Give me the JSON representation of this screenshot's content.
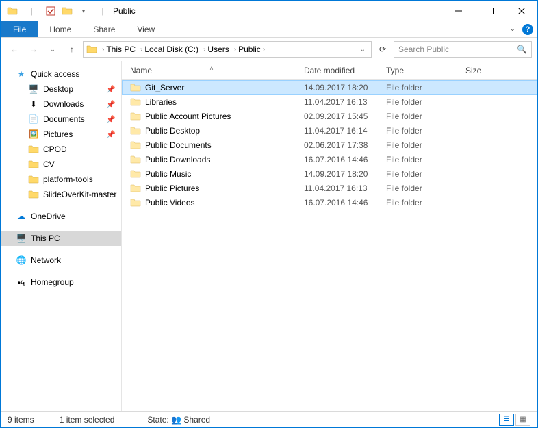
{
  "titlebar": {
    "title": "Public"
  },
  "ribbon": {
    "file": "File",
    "tabs": [
      "Home",
      "Share",
      "View"
    ]
  },
  "breadcrumbs": [
    "This PC",
    "Local Disk (C:)",
    "Users",
    "Public"
  ],
  "search": {
    "placeholder": "Search Public"
  },
  "columns": {
    "name": "Name",
    "date": "Date modified",
    "type": "Type",
    "size": "Size"
  },
  "navpane": {
    "quick_access": "Quick access",
    "items": [
      {
        "label": "Desktop",
        "pinned": true,
        "icon": "desktop"
      },
      {
        "label": "Downloads",
        "pinned": true,
        "icon": "downloads"
      },
      {
        "label": "Documents",
        "pinned": true,
        "icon": "documents"
      },
      {
        "label": "Pictures",
        "pinned": true,
        "icon": "pictures"
      },
      {
        "label": "CPOD",
        "pinned": false,
        "icon": "folder"
      },
      {
        "label": "CV",
        "pinned": false,
        "icon": "folder"
      },
      {
        "label": "platform-tools",
        "pinned": false,
        "icon": "folder"
      },
      {
        "label": "SlideOverKit-master",
        "pinned": false,
        "icon": "folder"
      }
    ],
    "onedrive": "OneDrive",
    "thispc": "This PC",
    "network": "Network",
    "homegroup": "Homegroup"
  },
  "files": [
    {
      "name": "Git_Server",
      "date": "14.09.2017 18:20",
      "type": "File folder",
      "selected": true
    },
    {
      "name": "Libraries",
      "date": "11.04.2017 16:13",
      "type": "File folder"
    },
    {
      "name": "Public Account Pictures",
      "date": "02.09.2017 15:45",
      "type": "File folder"
    },
    {
      "name": "Public Desktop",
      "date": "11.04.2017 16:14",
      "type": "File folder"
    },
    {
      "name": "Public Documents",
      "date": "02.06.2017 17:38",
      "type": "File folder"
    },
    {
      "name": "Public Downloads",
      "date": "16.07.2016 14:46",
      "type": "File folder"
    },
    {
      "name": "Public Music",
      "date": "14.09.2017 18:20",
      "type": "File folder"
    },
    {
      "name": "Public Pictures",
      "date": "11.04.2017 16:13",
      "type": "File folder"
    },
    {
      "name": "Public Videos",
      "date": "16.07.2016 14:46",
      "type": "File folder"
    }
  ],
  "status": {
    "count": "9 items",
    "selected": "1 item selected",
    "state_label": "State:",
    "state_value": "Shared"
  }
}
